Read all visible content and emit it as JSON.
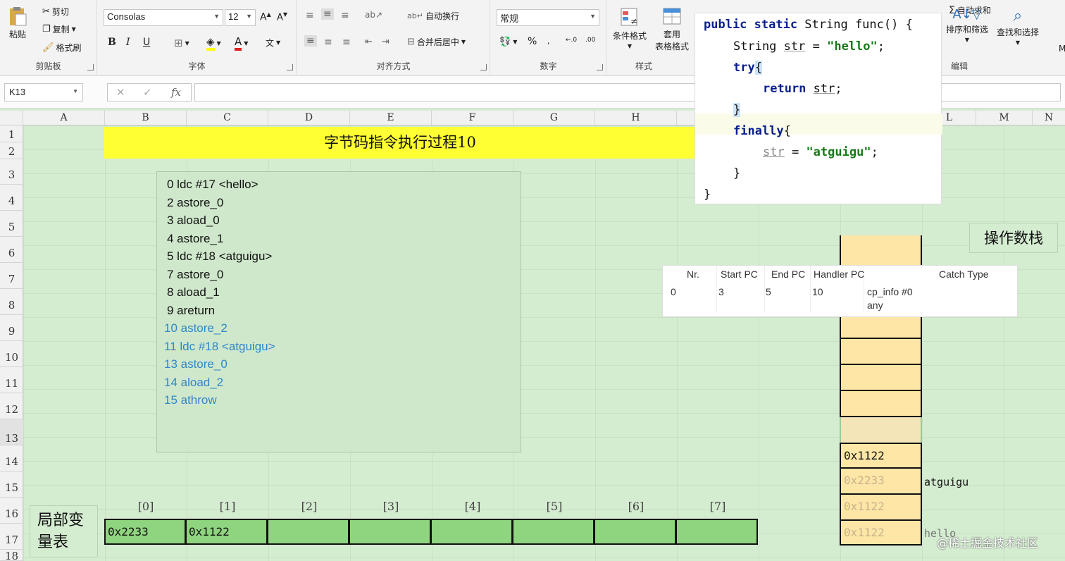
{
  "ribbon": {
    "clipboard": {
      "paste": "粘贴",
      "cut": "剪切",
      "copy": "复制",
      "format_painter": "格式刷",
      "group_label": "剪贴板"
    },
    "font": {
      "font_name": "Consolas",
      "font_size": "12",
      "bold": "B",
      "italic": "I",
      "underline": "U",
      "font_color_glyph": "A",
      "group_label": "字体"
    },
    "alignment": {
      "wrap_text": "自动换行",
      "merge_center": "合并后居中",
      "group_label": "对齐方式"
    },
    "number": {
      "format": "常规",
      "percent": "%",
      "group_label": "数字"
    },
    "styles": {
      "conditional": "条件格式",
      "table_format_1": "套用",
      "table_format_2": "表格格式",
      "group_label": "样式"
    },
    "editing": {
      "autosum": "自动求和",
      "sort_filter": "排序和筛选",
      "find_select": "查找和选择",
      "group_label": "编辑",
      "extra": "M"
    }
  },
  "formula_bar": {
    "name_box": "K13",
    "fx": "fx"
  },
  "columns": [
    "A",
    "B",
    "C",
    "D",
    "E",
    "F",
    "G",
    "H",
    "L",
    "M",
    "N"
  ],
  "rows": [
    "1",
    "2",
    "3",
    "4",
    "5",
    "6",
    "7",
    "8",
    "9",
    "10",
    "11",
    "12",
    "13",
    "14",
    "15",
    "16",
    "17",
    "18"
  ],
  "sheet_title": "字节码指令执行过程10",
  "bytecode": [
    {
      "text": "0 ldc #17 <hello>",
      "color": "#111111"
    },
    {
      "text": "2 astore_0",
      "color": "#111111"
    },
    {
      "text": "3 aload_0",
      "color": "#111111"
    },
    {
      "text": "4 astore_1",
      "color": "#111111"
    },
    {
      "text": "5 ldc #18 <atguigu>",
      "color": "#111111"
    },
    {
      "text": "7 astore_0",
      "color": "#111111"
    },
    {
      "text": "8 aload_1",
      "color": "#111111"
    },
    {
      "text": "9 areturn",
      "color": "#111111"
    },
    {
      "text": "10 astore_2",
      "color": "#2e87c8"
    },
    {
      "text": "11 ldc #18 <atguigu>",
      "color": "#2e87c8"
    },
    {
      "text": "13 astore_0",
      "color": "#2e87c8"
    },
    {
      "text": "14 aload_2",
      "color": "#2e87c8"
    },
    {
      "text": "15 athrow",
      "color": "#2e87c8"
    }
  ],
  "code": {
    "l1_kw": "public static",
    "l1_rest": " String func() {",
    "l2_a": "String ",
    "l2_var": "str",
    "l2_b": " = ",
    "l2_str": "\"hello\"",
    "l2_c": ";",
    "l3_kw": "try",
    "l3_b": "{",
    "l4_kw": "return",
    "l4_var": "str",
    "l4_c": ";",
    "l5": "}",
    "l6_kw": "finally",
    "l6_b": "{",
    "l7_var": "str",
    "l7_b": " = ",
    "l7_str": "\"atguigu\"",
    "l7_c": ";",
    "l8": "}",
    "l9": "}"
  },
  "operand_stack": {
    "label": "操作数栈",
    "cells": [
      "",
      "",
      "",
      "",
      "",
      "",
      "",
      "",
      "0x1122",
      "0x2233",
      "0x1122",
      "0x1122"
    ],
    "side_atguigu": "atguigu",
    "side_hello": "hello"
  },
  "exception_table": {
    "headers": [
      "Nr.",
      "Start PC",
      "End PC",
      "Handler PC",
      "Catch Type"
    ],
    "row": [
      "0",
      "3",
      "5",
      "10",
      "cp_info #0",
      "any"
    ]
  },
  "local_vars": {
    "label_1": "局部变",
    "label_2": "量表",
    "indices": [
      "[0]",
      "[1]",
      "[2]",
      "[3]",
      "[4]",
      "[5]",
      "[6]",
      "[7]"
    ],
    "values": [
      "0x2233",
      "0x1122",
      "",
      "",
      "",
      "",
      "",
      ""
    ]
  },
  "watermark": "@稀土掘金技术社区"
}
